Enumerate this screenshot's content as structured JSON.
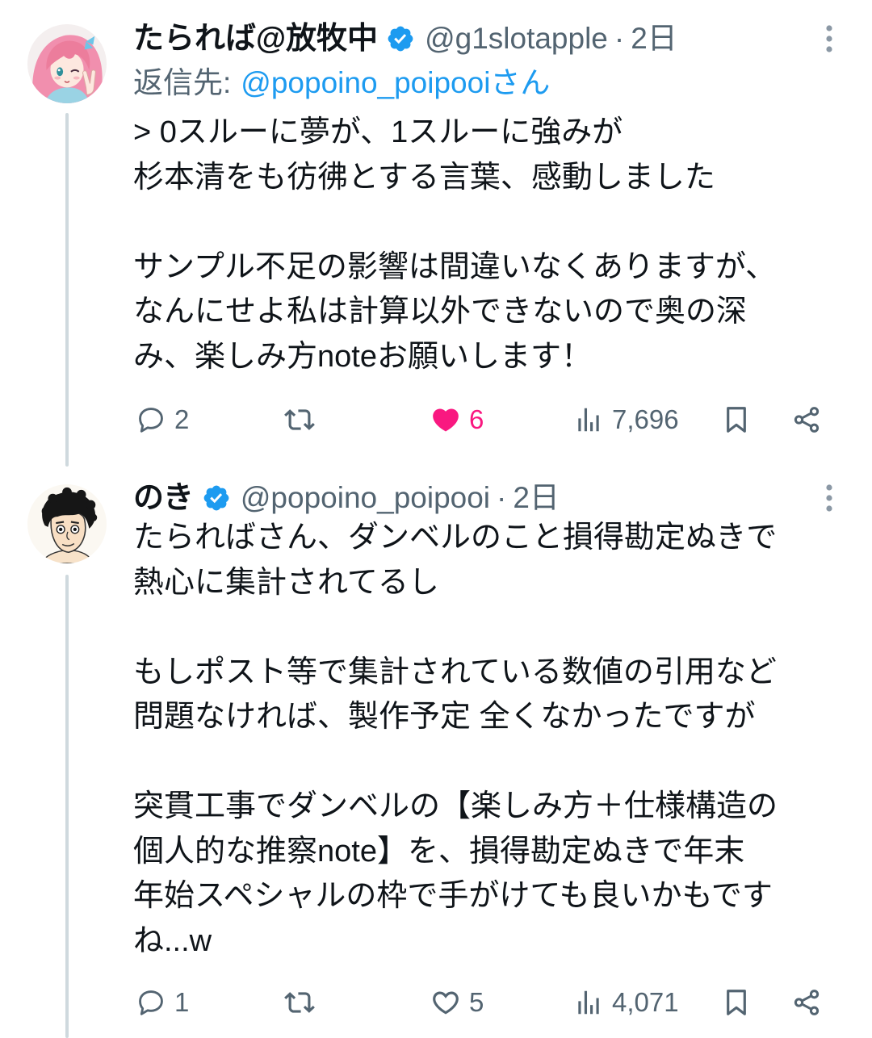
{
  "colors": {
    "background": "#ffffff",
    "text": "#0f1419",
    "secondary_text": "#536471",
    "link": "#1d9bf0",
    "verified_badge": "#1d9bf0",
    "liked": "#f91880",
    "thread_line": "#cfd9de"
  },
  "icons": {
    "more": "more-vertical-icon",
    "verified": "verified-badge-icon",
    "reply": "reply-icon",
    "repost": "repost-icon",
    "like": "heart-icon",
    "views": "views-icon",
    "bookmark": "bookmark-icon",
    "share": "share-icon"
  },
  "tweets": [
    {
      "author": {
        "name": "たられば@放牧中",
        "handle": "@g1slotapple",
        "verified": true
      },
      "separator": "·",
      "time": "2日",
      "reply_to": {
        "label": "返信先:",
        "handle": "@popoino_poipooiさん"
      },
      "paragraphs": [
        [
          "> 0スルーに夢が、1スルーに強みが",
          "杉本清をも彷彿とする言葉、感動しました"
        ],
        [
          "サンプル不足の影響は間違いなくありますが、",
          "なんにせよ私は計算以外できないので奥の深",
          "み、楽しみ方noteお願いします！"
        ]
      ],
      "actions": {
        "reply_count": "2",
        "like_count": "6",
        "liked": true,
        "views": "7,696"
      }
    },
    {
      "author": {
        "name": "のき",
        "handle": "@popoino_poipooi",
        "verified": true
      },
      "separator": "·",
      "time": "2日",
      "paragraphs": [
        [
          "たらればさん、ダンベルのこと損得勘定ぬきで",
          "熱心に集計されてるし"
        ],
        [
          "もしポスト等で集計されている数値の引用など",
          "問題なければ、製作予定 全くなかったですが"
        ],
        [
          "突貫工事でダンベルの【楽しみ方＋仕様構造の",
          "個人的な推察note】を、損得勘定ぬきで年末",
          "年始スペシャルの枠で手がけても良いかもです",
          "ね...w"
        ]
      ],
      "actions": {
        "reply_count": "1",
        "like_count": "5",
        "liked": false,
        "views": "4,071"
      }
    }
  ]
}
